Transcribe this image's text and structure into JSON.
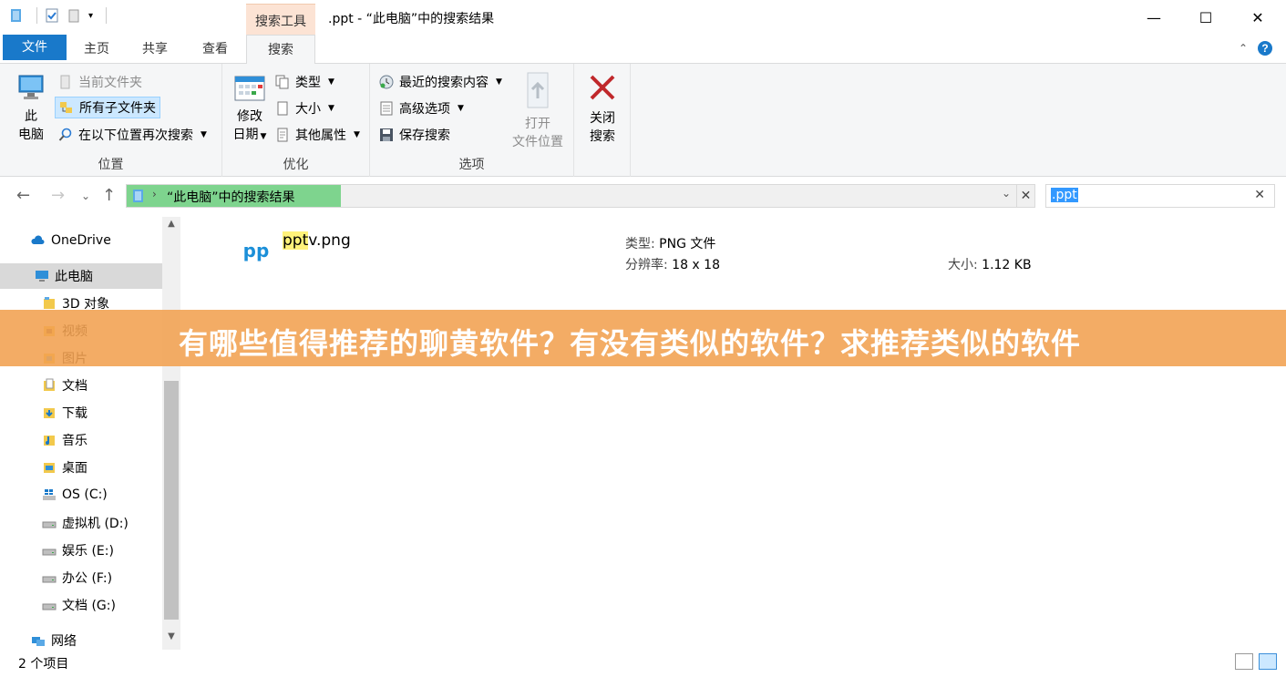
{
  "titlebar": {
    "context_tab": "搜索工具",
    "title": ".ppt - “此电脑”中的搜索结果",
    "minimize": "—",
    "maximize": "☐",
    "close": "✕"
  },
  "tabs": {
    "file": "文件",
    "home": "主页",
    "share": "共享",
    "view": "查看",
    "search": "搜索"
  },
  "ribbon": {
    "location": {
      "this_pc_line1": "此",
      "this_pc_line2": "电脑",
      "current_folder": "当前文件夹",
      "all_subfolders": "所有子文件夹",
      "search_again": "在以下位置再次搜索",
      "label": "位置"
    },
    "refine": {
      "date_modified_line1": "修改",
      "date_modified_line2": "日期",
      "kind": "类型",
      "size": "大小",
      "other_props": "其他属性",
      "label": "优化"
    },
    "options": {
      "recent": "最近的搜索内容",
      "advanced": "高级选项",
      "save": "保存搜索",
      "open_loc_line1": "打开",
      "open_loc_line2": "文件位置",
      "label": "选项"
    },
    "close": {
      "line1": "关闭",
      "line2": "搜索"
    }
  },
  "address": {
    "path": "“此电脑”中的搜索结果",
    "search_value": ".ppt"
  },
  "navpane": {
    "items": [
      {
        "label": "OneDrive"
      },
      {
        "label": "此电脑"
      },
      {
        "label": "3D 对象"
      },
      {
        "label": "视频"
      },
      {
        "label": "图片"
      },
      {
        "label": "文档"
      },
      {
        "label": "下载"
      },
      {
        "label": "音乐"
      },
      {
        "label": "桌面"
      },
      {
        "label": "OS (C:)"
      },
      {
        "label": "虚拟机 (D:)"
      },
      {
        "label": "娱乐 (E:)"
      },
      {
        "label": "办公 (F:)"
      },
      {
        "label": "文档 (G:)"
      },
      {
        "label": "网络"
      }
    ]
  },
  "results": {
    "file": {
      "name_highlight": "ppt",
      "name_rest": "v.png",
      "type_label": "类型:",
      "type_value": "PNG 文件",
      "dims_label": "分辨率:",
      "dims_value": "18 x 18",
      "size_label": "大小:",
      "size_value": "1.12 KB"
    }
  },
  "status": {
    "count": "2 个项目"
  },
  "banner": {
    "text": "有哪些值得推荐的聊黄软件？有没有类似的软件？求推荐类似的软件"
  },
  "colors": {
    "file_tab": "#1979ca",
    "context_tab": "#fce3d4",
    "banner": "#f1a150",
    "address_highlight": "#7ed48e"
  }
}
